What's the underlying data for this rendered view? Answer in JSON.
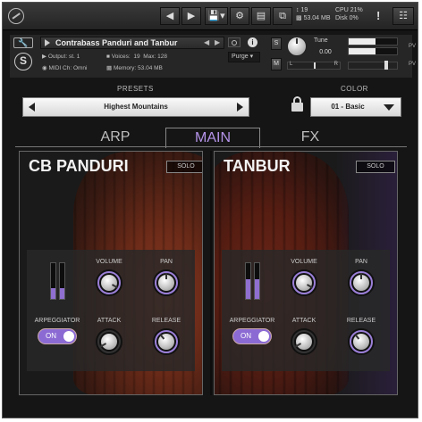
{
  "toolbar": {
    "midi_count": "19",
    "memory": "53.04 MB",
    "cpu_label": "CPU",
    "cpu_value": "21%",
    "disk_label": "Disk",
    "disk_value": "0%",
    "warn": "!"
  },
  "instrument": {
    "name": "Contrabass Panduri and Tanbur",
    "output_label": "Output:",
    "output_value": "st. 1",
    "voices_label": "Voices:",
    "voices_value": "19",
    "max_label": "Max:",
    "max_value": "128",
    "midi_label": "MIDI Ch:",
    "midi_value": "Omni",
    "memory_label": "Memory:",
    "memory_value": "53.04 MB",
    "purge": "Purge",
    "s": "S",
    "m": "M",
    "tune_label": "Tune",
    "tune_value": "0.00",
    "pan_l": "L",
    "pan_r": "R",
    "pv1": "PV",
    "pv2": "PV"
  },
  "presets": {
    "label": "PRESETS",
    "value": "Highest Mountains"
  },
  "color": {
    "label": "COLOR",
    "value": "01 - Basic"
  },
  "tabs": [
    "ARP",
    "MAIN",
    "FX"
  ],
  "active_tab": "MAIN",
  "panels": [
    {
      "title": "CB PANDURI",
      "solo": "SOLO",
      "volume_label": "VOLUME",
      "pan_label": "PAN",
      "arp_label": "ARPEGGIATOR",
      "arp_value": "ON",
      "attack_label": "ATTACK",
      "release_label": "RELEASE",
      "meter_levels": [
        0.3,
        0.3
      ],
      "volume_level": 0.75,
      "pan_level": 0.5,
      "attack_level": 0.1,
      "release_level": 0.3
    },
    {
      "title": "TANBUR",
      "solo": "SOLO",
      "volume_label": "VOLUME",
      "pan_label": "PAN",
      "arp_label": "ARPEGGIATOR",
      "arp_value": "ON",
      "attack_label": "ATTACK",
      "release_label": "RELEASE",
      "meter_levels": [
        0.55,
        0.55
      ],
      "volume_level": 0.75,
      "pan_level": 0.5,
      "attack_level": 0.1,
      "release_level": 0.35
    }
  ],
  "colors": {
    "accent": "#9b7fd8",
    "active_tab": "#b493e8"
  },
  "icons": [
    "kontakt-logo-icon",
    "chevron-left-icon",
    "chevron-right-icon",
    "save-icon",
    "gear-icon",
    "view-icon",
    "rack-icon",
    "warning-icon",
    "keyboard-icon",
    "wrench-icon",
    "s-logo-icon",
    "camera-icon",
    "info-icon",
    "lock-icon"
  ]
}
